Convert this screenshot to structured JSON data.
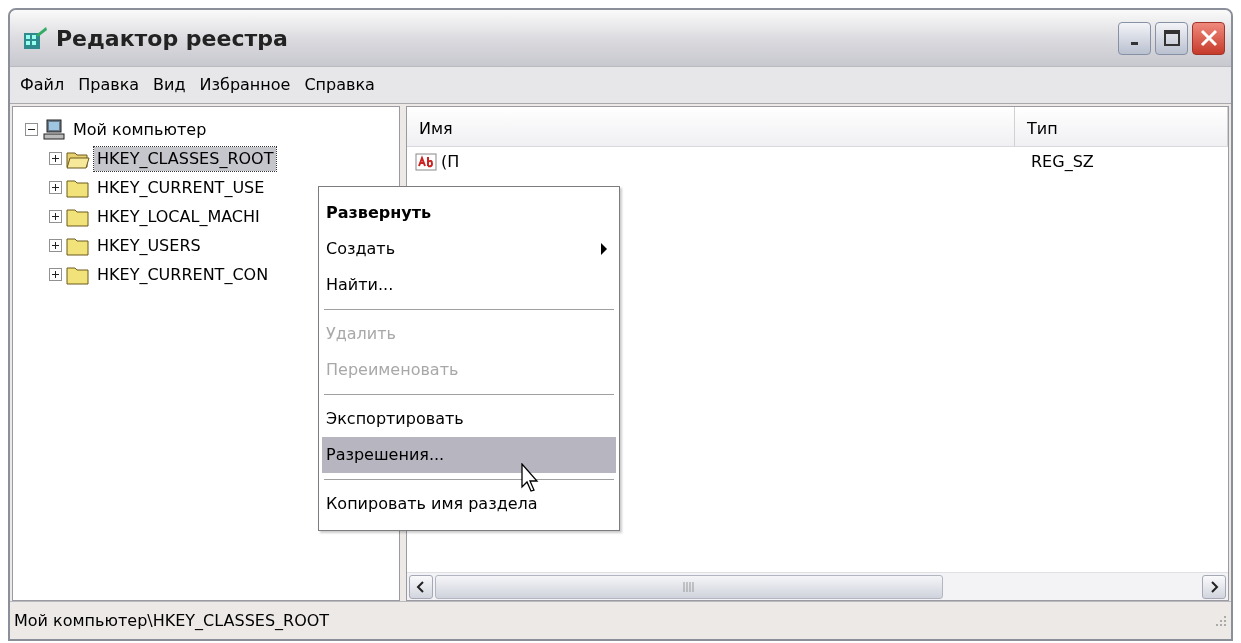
{
  "window": {
    "title": "Редактор реестра"
  },
  "menu_bar": [
    "Файл",
    "Правка",
    "Вид",
    "Избранное",
    "Справка"
  ],
  "tree": {
    "label": "Мой компьютер",
    "expanded": true,
    "children": [
      {
        "label": "HKEY_CLASSES_ROOT",
        "expanded": false,
        "selected": true
      },
      {
        "label": "HKEY_CURRENT_USE",
        "expanded": false,
        "selected": false
      },
      {
        "label": "HKEY_LOCAL_MACHI",
        "expanded": false,
        "selected": false
      },
      {
        "label": "HKEY_USERS",
        "expanded": false,
        "selected": false
      },
      {
        "label": "HKEY_CURRENT_CON",
        "expanded": false,
        "selected": false
      }
    ]
  },
  "values": {
    "columns": [
      "Имя",
      "Тип"
    ],
    "rows": [
      {
        "name": "(П",
        "type": "REG_SZ"
      }
    ]
  },
  "context_menu": [
    {
      "kind": "item",
      "label": "Развернуть",
      "default": true,
      "disabled": false,
      "selected": false,
      "submenu": false
    },
    {
      "kind": "item",
      "label": "Создать",
      "default": false,
      "disabled": false,
      "selected": false,
      "submenu": true
    },
    {
      "kind": "item",
      "label": "Найти...",
      "default": false,
      "disabled": false,
      "selected": false,
      "submenu": false
    },
    {
      "kind": "separator"
    },
    {
      "kind": "item",
      "label": "Удалить",
      "default": false,
      "disabled": true,
      "selected": false,
      "submenu": false
    },
    {
      "kind": "item",
      "label": "Переименовать",
      "default": false,
      "disabled": true,
      "selected": false,
      "submenu": false
    },
    {
      "kind": "separator"
    },
    {
      "kind": "item",
      "label": "Экспортировать",
      "default": false,
      "disabled": false,
      "selected": false,
      "submenu": false
    },
    {
      "kind": "item",
      "label": "Разрешения...",
      "default": false,
      "disabled": false,
      "selected": true,
      "submenu": false
    },
    {
      "kind": "separator"
    },
    {
      "kind": "item",
      "label": "Копировать имя раздела",
      "default": false,
      "disabled": false,
      "selected": false,
      "submenu": false
    }
  ],
  "status_bar": "Мой компьютер\\HKEY_CLASSES_ROOT"
}
